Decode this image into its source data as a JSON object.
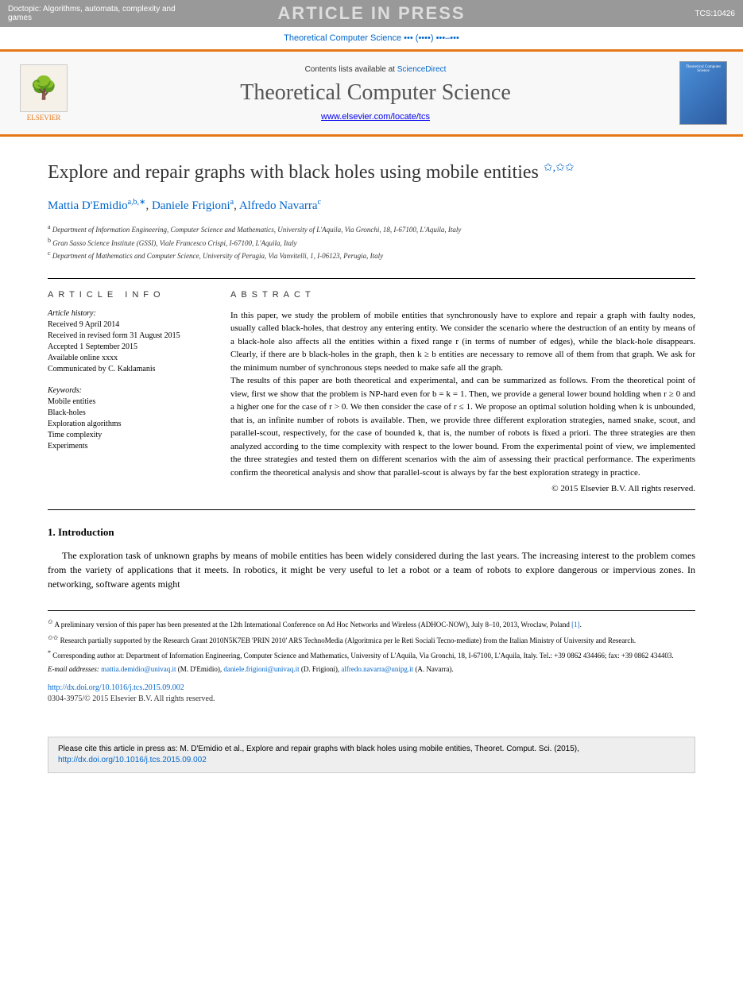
{
  "header": {
    "doctopic": "Doctopic: Algorithms, automata, complexity and games",
    "aip": "ARTICLE IN PRESS",
    "tcs_id": "TCS:10426"
  },
  "journal_ref": "Theoretical Computer Science ••• (••••) •••–•••",
  "journal_header": {
    "elsevier": "ELSEVIER",
    "contents_prefix": "Contents lists available at ",
    "contents_link": "ScienceDirect",
    "title": "Theoretical Computer Science",
    "url": "www.elsevier.com/locate/tcs",
    "cover_text": "Theoretical Computer Science"
  },
  "article": {
    "title": "Explore and repair graphs with black holes using mobile entities",
    "title_marks": "✩,✩✩"
  },
  "authors": [
    {
      "name": "Mattia D'Emidio",
      "sup": "a,b,∗"
    },
    {
      "name": "Daniele Frigioni",
      "sup": "a"
    },
    {
      "name": "Alfredo Navarra",
      "sup": "c"
    }
  ],
  "affiliations": [
    {
      "sup": "a",
      "text": "Department of Information Engineering, Computer Science and Mathematics, University of L'Aquila, Via Gronchi, 18, I-67100, L'Aquila, Italy"
    },
    {
      "sup": "b",
      "text": "Gran Sasso Science Institute (GSSI), Viale Francesco Crispi, I-67100, L'Aquila, Italy"
    },
    {
      "sup": "c",
      "text": "Department of Mathematics and Computer Science, University of Perugia, Via Vanvitelli, 1, I-06123, Perugia, Italy"
    }
  ],
  "info": {
    "heading": "ARTICLE INFO",
    "history_label": "Article history:",
    "history": [
      "Received 9 April 2014",
      "Received in revised form 31 August 2015",
      "Accepted 1 September 2015",
      "Available online xxxx",
      "Communicated by C. Kaklamanis"
    ],
    "keywords_label": "Keywords:",
    "keywords": [
      "Mobile entities",
      "Black-holes",
      "Exploration algorithms",
      "Time complexity",
      "Experiments"
    ]
  },
  "abstract": {
    "heading": "ABSTRACT",
    "p1": "In this paper, we study the problem of mobile entities that synchronously have to explore and repair a graph with faulty nodes, usually called black-holes, that destroy any entering entity. We consider the scenario where the destruction of an entity by means of a black-hole also affects all the entities within a fixed range r (in terms of number of edges), while the black-hole disappears. Clearly, if there are b black-holes in the graph, then k ≥ b entities are necessary to remove all of them from that graph. We ask for the minimum number of synchronous steps needed to make safe all the graph.",
    "p2": "The results of this paper are both theoretical and experimental, and can be summarized as follows. From the theoretical point of view, first we show that the problem is NP-hard even for b = k = 1. Then, we provide a general lower bound holding when r ≥ 0 and a higher one for the case of r > 0. We then consider the case of r ≤ 1. We propose an optimal solution holding when k is unbounded, that is, an infinite number of robots is available. Then, we provide three different exploration strategies, named snake, scout, and parallel-scout, respectively, for the case of bounded k, that is, the number of robots is fixed a priori. The three strategies are then analyzed according to the time complexity with respect to the lower bound. From the experimental point of view, we implemented the three strategies and tested them on different scenarios with the aim of assessing their practical performance. The experiments confirm the theoretical analysis and show that parallel-scout is always by far the best exploration strategy in practice.",
    "copyright": "© 2015 Elsevier B.V. All rights reserved."
  },
  "section1": {
    "title": "1. Introduction",
    "text": "The exploration task of unknown graphs by means of mobile entities has been widely considered during the last years. The increasing interest to the problem comes from the variety of applications that it meets. In robotics, it might be very useful to let a robot or a team of robots to explore dangerous or impervious zones. In networking, software agents might"
  },
  "footnotes": {
    "f1_mark": "✩",
    "f1": "A preliminary version of this paper has been presented at the 12th International Conference on Ad Hoc Networks and Wireless (ADHOC-NOW), July 8–10, 2013, Wroclaw, Poland [1].",
    "f2_mark": "✩✩",
    "f2": "Research partially supported by the Research Grant 2010N5K7EB 'PRIN 2010' ARS TechnoMedia (Algoritmica per le Reti Sociali Tecno-mediate) from the Italian Ministry of University and Research.",
    "f3_mark": "*",
    "f3": "Corresponding author at: Department of Information Engineering, Computer Science and Mathematics, University of L'Aquila, Via Gronchi, 18, I-67100, L'Aquila, Italy. Tel.: +39 0862 434466; fax: +39 0862 434403.",
    "email_label": "E-mail addresses:",
    "emails": [
      {
        "addr": "mattia.demidio@univaq.it",
        "who": "(M. D'Emidio)"
      },
      {
        "addr": "daniele.frigioni@univaq.it",
        "who": "(D. Frigioni)"
      },
      {
        "addr": "alfredo.navarra@unipg.it",
        "who": "(A. Navarra)"
      }
    ]
  },
  "doi": {
    "url": "http://dx.doi.org/10.1016/j.tcs.2015.09.002",
    "issn": "0304-3975/© 2015 Elsevier B.V. All rights reserved."
  },
  "cite_box": {
    "text": "Please cite this article in press as: M. D'Emidio et al., Explore and repair graphs with black holes using mobile entities, Theoret. Comput. Sci. (2015), ",
    "url": "http://dx.doi.org/10.1016/j.tcs.2015.09.002"
  }
}
